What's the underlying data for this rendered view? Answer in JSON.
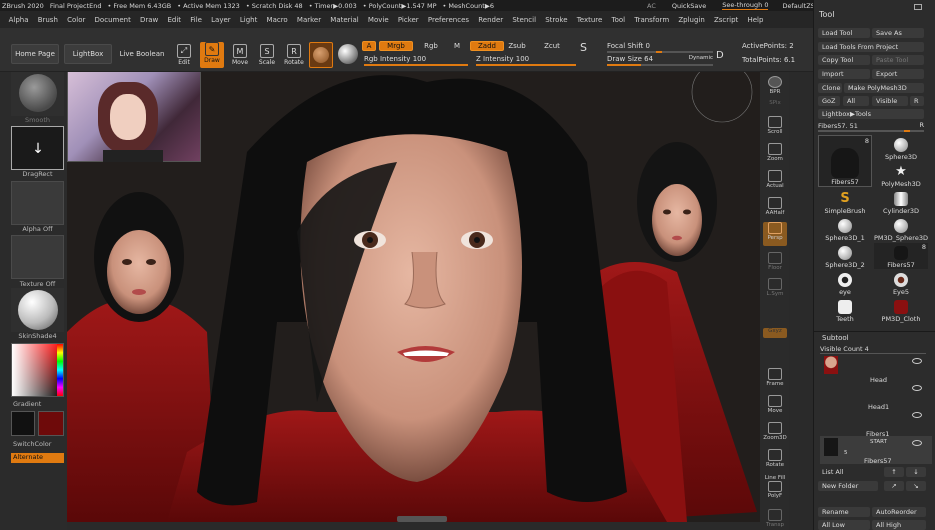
{
  "titlebar": {
    "items": [
      "ZBrush 2020",
      "Final ProjectEnd",
      "• Free Mem 6.43GB",
      "• Active Mem 1323",
      "• Scratch Disk 48",
      "• Timer▶0.003",
      "• PolyCount▶1.547 MP",
      "• MeshCount▶6"
    ],
    "ac": "AC",
    "quicksave": "QuickSave",
    "seethrough": "See-through",
    "seethrough_value": "0",
    "default_script": "DefaultZScript"
  },
  "menu": [
    "Alpha",
    "Brush",
    "Color",
    "Document",
    "Draw",
    "Edit",
    "File",
    "Layer",
    "Light",
    "Macro",
    "Marker",
    "Material",
    "Movie",
    "Picker",
    "Preferences",
    "Render",
    "Stencil",
    "Stroke",
    "Texture",
    "Tool",
    "Transform",
    "Zplugin",
    "Zscript",
    "Help"
  ],
  "shelf": {
    "home_page": "Home Page",
    "lightbox": "LightBox",
    "live_boolean": "Live Boolean",
    "tools": [
      {
        "label": "Edit",
        "glyph": "⤢"
      },
      {
        "label": "Draw",
        "glyph": "✎"
      },
      {
        "label": "Move",
        "glyph": "M"
      },
      {
        "label": "Scale",
        "glyph": "S"
      },
      {
        "label": "Rotate",
        "glyph": "R"
      }
    ],
    "a": "A",
    "mrgb": "Mrgb",
    "rgb": "Rgb",
    "m": "M",
    "zadd": "Zadd",
    "zsub": "Zsub",
    "zcut": "Zcut",
    "rgb_intensity_label": "Rgb Intensity",
    "rgb_intensity": "100",
    "z_intensity_label": "Z Intensity",
    "z_intensity": "100",
    "focal_shift_label": "Focal Shift",
    "focal_shift": "0",
    "draw_size_label": "Draw Size",
    "draw_size": "64",
    "dynamic": "Dynamic",
    "active_points": "ActivePoints: 2",
    "total_points": "TotalPoints: 6.1"
  },
  "left": {
    "smooth": "Smooth",
    "dragrect": "DragRect",
    "alpha_off": "Alpha Off",
    "texture_off": "Texture Off",
    "material": "SkinShade4",
    "gradient": "Gradient",
    "switch_color": "SwitchColor",
    "alternate": "Alternate"
  },
  "rstrip": [
    "BPR",
    "SPix",
    "Scroll",
    "Zoom",
    "Actual",
    "AAHalf",
    "Persp",
    "Floor",
    "L.Sym",
    "Gxyz",
    "Frame",
    "Move",
    "Zoom3D",
    "Rotate",
    "Line Fill",
    "PolyF",
    "Transp"
  ],
  "toolpanel": {
    "title": "Tool",
    "load_tool": "Load Tool",
    "save_as": "Save As",
    "load_from_project": "Load Tools From Project",
    "copy_tool": "Copy Tool",
    "paste_tool": "Paste Tool",
    "import": "Import",
    "export": "Export",
    "clone": "Clone",
    "make_polymesh": "Make PolyMesh3D",
    "goz": "GoZ",
    "all": "All",
    "visible": "Visible",
    "r": "R",
    "lightbox_tools": "Lightbox▶Tools",
    "current_tool": "Fibers57.",
    "current_tool_value": "51",
    "tools": [
      {
        "name": "Fibers57",
        "badge": "8"
      },
      {
        "name": "Sphere3D",
        "badge": ""
      },
      {
        "name": "",
        "badge": ""
      },
      {
        "name": "PolyMesh3D",
        "badge": ""
      },
      {
        "name": "SimpleBrush",
        "badge": ""
      },
      {
        "name": "Cylinder3D",
        "badge": ""
      },
      {
        "name": "Sphere3D_1",
        "badge": ""
      },
      {
        "name": "PM3D_Sphere3D",
        "badge": ""
      },
      {
        "name": "Sphere3D_2",
        "badge": ""
      },
      {
        "name": "Fibers57",
        "badge": "8"
      },
      {
        "name": "eye",
        "badge": ""
      },
      {
        "name": "Eye5",
        "badge": ""
      },
      {
        "name": "Teeth",
        "badge": ""
      },
      {
        "name": "PM3D_Cloth",
        "badge": ""
      }
    ],
    "subtool": "Subtool",
    "visible_count": "Visible Count 4",
    "subtools": [
      {
        "name": "Head"
      },
      {
        "name": "Head1"
      },
      {
        "name": "Fibers1"
      },
      {
        "name": "Fibers57",
        "start": "START",
        "num": "5"
      }
    ],
    "list_all": "List All",
    "new_folder": "New Folder",
    "rename": "Rename",
    "auto_reorder": "AutoReorder",
    "all_low": "All Low",
    "all_high": "All High"
  },
  "colors": {
    "accent": "#e07a10",
    "shirt": "#8a1414",
    "skin": "#d9a58e"
  }
}
